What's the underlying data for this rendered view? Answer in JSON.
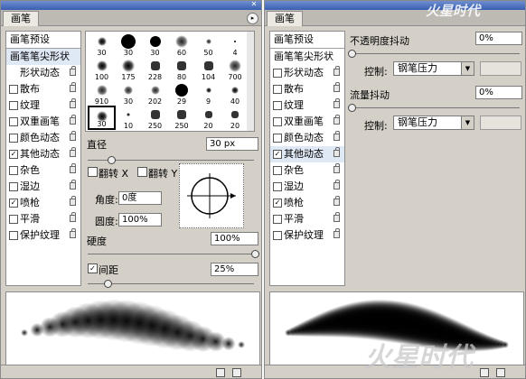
{
  "left": {
    "tab": "画笔",
    "presets": "画笔预设",
    "options": [
      {
        "label": "画笔笔尖形状",
        "check": false,
        "selected": true,
        "first": true
      },
      {
        "label": "形状动态",
        "check": false,
        "checked": false
      },
      {
        "label": "散布",
        "check": true,
        "checked": false
      },
      {
        "label": "纹理",
        "check": true,
        "checked": false
      },
      {
        "label": "双重画笔",
        "check": true,
        "checked": false
      },
      {
        "label": "颜色动态",
        "check": true,
        "checked": false
      },
      {
        "label": "其他动态",
        "check": true,
        "checked": true
      },
      {
        "label": "杂色",
        "check": true,
        "checked": false
      },
      {
        "label": "湿边",
        "check": true,
        "checked": false
      },
      {
        "label": "喷枪",
        "check": true,
        "checked": true
      },
      {
        "label": "平滑",
        "check": true,
        "checked": false
      },
      {
        "label": "保护纹理",
        "check": true,
        "checked": false
      }
    ],
    "brushes": [
      {
        "size": "30",
        "type": "soft",
        "d": 10
      },
      {
        "size": "30",
        "type": "hard",
        "d": 16
      },
      {
        "size": "30",
        "type": "hard",
        "d": 12
      },
      {
        "size": "60",
        "type": "spatter",
        "d": 14
      },
      {
        "size": "50",
        "type": "spatter",
        "d": 6
      },
      {
        "size": "4",
        "type": "hard",
        "d": 2
      },
      {
        "size": "100",
        "type": "soft",
        "d": 12
      },
      {
        "size": "175",
        "type": "soft",
        "d": 14
      },
      {
        "size": "228",
        "type": "leaf",
        "d": 10
      },
      {
        "size": "80",
        "type": "leaf",
        "d": 10
      },
      {
        "size": "104",
        "type": "leaf",
        "d": 10
      },
      {
        "size": "700",
        "type": "spatter",
        "d": 14
      },
      {
        "size": "910",
        "type": "spatter",
        "d": 12
      },
      {
        "size": "30",
        "type": "spatter",
        "d": 10
      },
      {
        "size": "202",
        "type": "spatter",
        "d": 10
      },
      {
        "size": "29",
        "type": "hard",
        "d": 14
      },
      {
        "size": "9",
        "type": "soft",
        "d": 6
      },
      {
        "size": "40",
        "type": "soft",
        "d": 8
      },
      {
        "size": "30",
        "type": "soft",
        "d": 12,
        "selected": true
      },
      {
        "size": "10",
        "type": "soft",
        "d": 4
      },
      {
        "size": "250",
        "type": "leaf",
        "d": 10
      },
      {
        "size": "250",
        "type": "leaf",
        "d": 10
      },
      {
        "size": "20",
        "type": "leaf",
        "d": 8
      },
      {
        "size": "20",
        "type": "leaf",
        "d": 8
      }
    ],
    "diameter_label": "直径",
    "diameter_value": "30 px",
    "flip_x": "翻转 X",
    "flip_y": "翻转 Y",
    "angle_label": "角度:",
    "angle_value": "0度",
    "roundness_label": "圆度:",
    "roundness_value": "100%",
    "hardness_label": "硬度",
    "hardness_value": "100%",
    "spacing_label": "间距",
    "spacing_value": "25%"
  },
  "right": {
    "tab": "画笔",
    "presets": "画笔预设",
    "options": [
      {
        "label": "画笔笔尖形状",
        "check": false,
        "selected": false,
        "first": true
      },
      {
        "label": "形状动态",
        "check": true,
        "checked": false
      },
      {
        "label": "散布",
        "check": true,
        "checked": false
      },
      {
        "label": "纹理",
        "check": true,
        "checked": false
      },
      {
        "label": "双重画笔",
        "check": true,
        "checked": false
      },
      {
        "label": "颜色动态",
        "check": true,
        "checked": false
      },
      {
        "label": "其他动态",
        "check": true,
        "checked": true,
        "selected": true
      },
      {
        "label": "杂色",
        "check": true,
        "checked": false
      },
      {
        "label": "湿边",
        "check": true,
        "checked": false
      },
      {
        "label": "喷枪",
        "check": true,
        "checked": true
      },
      {
        "label": "平滑",
        "check": true,
        "checked": false
      },
      {
        "label": "保护纹理",
        "check": true,
        "checked": false
      }
    ],
    "opacity_jitter_label": "不透明度抖动",
    "opacity_jitter_value": "0%",
    "control_label": "控制:",
    "control_value": "钢笔压力",
    "flow_jitter_label": "流量抖动",
    "flow_jitter_value": "0%",
    "control2_label": "控制:",
    "control2_value": "钢笔压力"
  },
  "watermark_top": "火星时代",
  "watermark_bottom": "火星时代"
}
